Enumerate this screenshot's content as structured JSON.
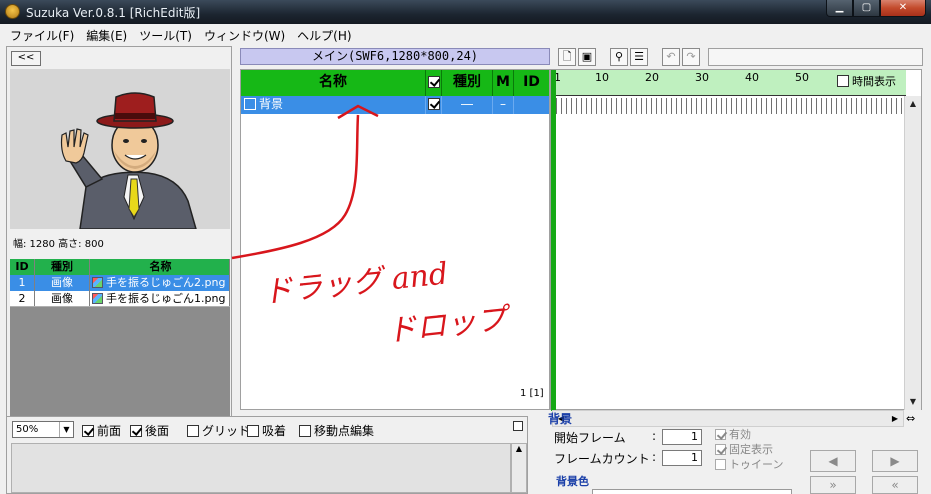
{
  "window": {
    "title": "Suzuka Ver.0.8.1 [RichEdit版]",
    "min": "▁",
    "max": "▢",
    "close": "✕"
  },
  "menu": [
    "ファイル(F)",
    "編集(E)",
    "ツール(T)",
    "ウィンドウ(W)",
    "ヘルプ(H)"
  ],
  "left": {
    "back_label": "<<",
    "dimensions": "幅: 1280 高さ: 800",
    "table": {
      "headers": [
        "ID",
        "種別",
        "名称"
      ],
      "rows": [
        {
          "id": "1",
          "type": "画像",
          "name": "手を振るじゅごん2.png"
        },
        {
          "id": "2",
          "type": "画像",
          "name": "手を振るじゅごん1.png"
        }
      ]
    }
  },
  "scene": {
    "label": "メイン(SWF6,1280*800,24)"
  },
  "layers": {
    "headers": {
      "name": "名称",
      "type": "種別",
      "m": "M",
      "id": "ID"
    },
    "rows": [
      {
        "name": "背景",
        "type": "―",
        "m": "–",
        "id": ""
      }
    ],
    "frame_count": "1 [1]"
  },
  "timeline": {
    "ruler": [
      "1",
      "10",
      "20",
      "30",
      "40",
      "50"
    ],
    "time_display": "時間表示"
  },
  "bottom": {
    "zoom": "50%",
    "opts": [
      "前面",
      "後面",
      "グリッド",
      "吸着",
      "移動点編集"
    ]
  },
  "props": {
    "title": "背景",
    "start_frame_label": "開始フレーム",
    "start_frame_value": "1",
    "frame_count_label": "フレームカウント",
    "frame_count_value": "1",
    "opt_enabled": "有効",
    "opt_fixed": "固定表示",
    "opt_tween": "トゥイーン",
    "bg_color_label": "背景色"
  },
  "annotation": {
    "line1": "ドラッグ and",
    "line2": "ドロップ"
  },
  "colors": {
    "accent_green": "#16b816",
    "selection_blue": "#3a8ee6",
    "annotation_red": "#d8161c"
  }
}
